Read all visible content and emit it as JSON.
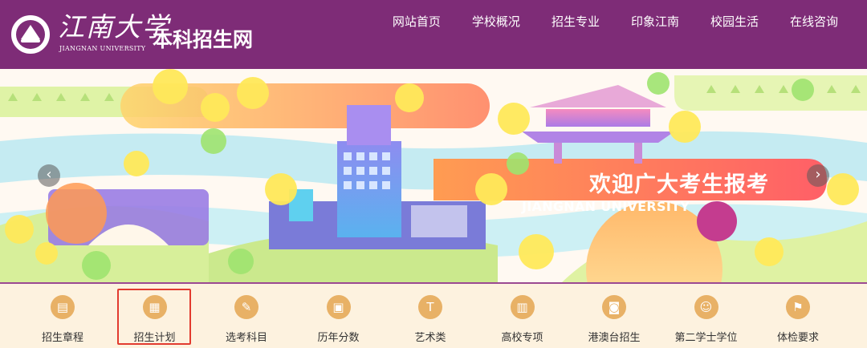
{
  "header": {
    "logo_cn": "江南大学",
    "logo_en": "JIANGNAN UNIVERSITY",
    "site_title": "本科招生网",
    "nav": [
      "网站首页",
      "学校概况",
      "招生专业",
      "印象江南",
      "校园生活",
      "在线咨询"
    ]
  },
  "banner": {
    "headline": "欢迎广大考生报考",
    "subheadline": "JIANGNAN UNIVERSITY",
    "prev_icon": "chevron-left-icon",
    "next_icon": "chevron-right-icon"
  },
  "quick_links": [
    {
      "label": "招生章程",
      "icon": "document-icon",
      "glyph": "▤",
      "selected": false
    },
    {
      "label": "招生计划",
      "icon": "calendar-icon",
      "glyph": "▦",
      "selected": true
    },
    {
      "label": "选考科目",
      "icon": "edit-icon",
      "glyph": "✎",
      "selected": false
    },
    {
      "label": "历年分数",
      "icon": "calendar-grid-icon",
      "glyph": "▣",
      "selected": false
    },
    {
      "label": "艺术类",
      "icon": "art-t-icon",
      "glyph": "T",
      "selected": false
    },
    {
      "label": "高校专项",
      "icon": "file-icon",
      "glyph": "▥",
      "selected": false
    },
    {
      "label": "港澳台招生",
      "icon": "id-card-icon",
      "glyph": "◙",
      "selected": false
    },
    {
      "label": "第二学士学位",
      "icon": "user-list-icon",
      "glyph": "☺",
      "selected": false
    },
    {
      "label": "体检要求",
      "icon": "running-icon",
      "glyph": "⚑",
      "selected": false
    }
  ],
  "colors": {
    "header_bg": "#7e2c77",
    "quick_bg": "#fdf2df",
    "icon_circle": "#e8b166",
    "highlight_border": "#e23b2f"
  }
}
